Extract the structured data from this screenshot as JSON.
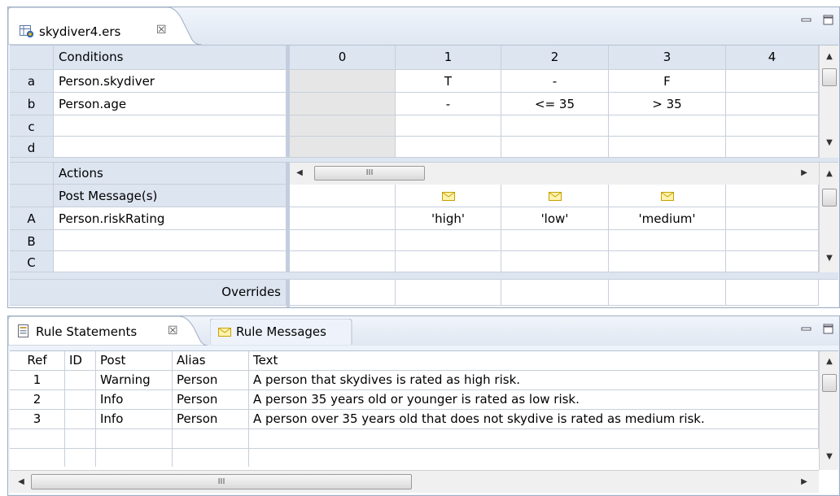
{
  "editor": {
    "tab_title": "skydiver4.ers",
    "tab_close": "☒",
    "minimize_icon": "minimize-icon",
    "maximize_icon": "maximize-icon"
  },
  "conditions": {
    "header": "Conditions",
    "rows": [
      {
        "id": "a",
        "label": "Person.skydiver",
        "values": [
          "",
          "T",
          "-",
          "F",
          ""
        ]
      },
      {
        "id": "b",
        "label": "Person.age",
        "values": [
          "",
          "-",
          "<= 35",
          "> 35",
          ""
        ]
      },
      {
        "id": "c",
        "label": "",
        "values": [
          "",
          "",
          "",
          "",
          ""
        ]
      },
      {
        "id": "d",
        "label": "",
        "values": [
          "",
          "",
          "",
          "",
          ""
        ]
      }
    ],
    "columns": [
      "0",
      "1",
      "2",
      "3",
      "4"
    ]
  },
  "actions": {
    "header": "Actions",
    "post_label": "Post Message(s)",
    "rows": [
      {
        "id": "A",
        "label": "Person.riskRating",
        "values": [
          "",
          "'high'",
          "'low'",
          "'medium'",
          ""
        ]
      },
      {
        "id": "B",
        "label": "",
        "values": [
          "",
          "",
          "",
          "",
          ""
        ]
      },
      {
        "id": "C",
        "label": "",
        "values": [
          "",
          "",
          "",
          "",
          ""
        ]
      }
    ],
    "overrides_label": "Overrides",
    "scroll_grip": "III"
  },
  "bottom_view": {
    "tabs": [
      {
        "label": "Rule Statements",
        "close": "☒",
        "icon": "document-icon"
      },
      {
        "label": "Rule Messages",
        "icon": "envelope-icon"
      }
    ],
    "columns": [
      "Ref",
      "ID",
      "Post",
      "Alias",
      "Text"
    ],
    "rows": [
      {
        "ref": "1",
        "id": "",
        "post": "Warning",
        "alias": "Person",
        "text": "A person that skydives is rated as high risk."
      },
      {
        "ref": "2",
        "id": "",
        "post": "Info",
        "alias": "Person",
        "text": "A person 35 years old or younger is rated as low risk."
      },
      {
        "ref": "3",
        "id": "",
        "post": "Info",
        "alias": "Person",
        "text": "A person over 35 years old that does not skydive is rated as medium risk."
      },
      {
        "ref": "",
        "id": "",
        "post": "",
        "alias": "",
        "text": ""
      }
    ],
    "scroll_grip": "III"
  },
  "colors": {
    "accent": "#d8a400",
    "header_bg": "#dde5f1",
    "frame": "#a0afc3"
  }
}
